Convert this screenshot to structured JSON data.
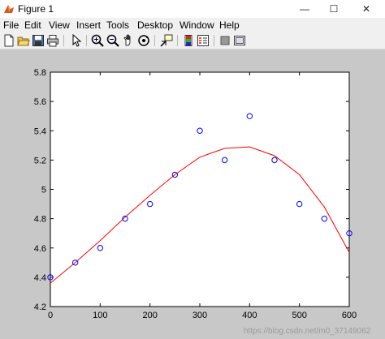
{
  "window": {
    "title": "Figure 1",
    "controls": {
      "minimize": "—",
      "maximize": "☐",
      "close": "✕"
    }
  },
  "menu": {
    "items": [
      "File",
      "Edit",
      "View",
      "Insert",
      "Tools",
      "Desktop",
      "Window",
      "Help"
    ]
  },
  "toolbar": {
    "icons": [
      "new-figure-icon",
      "open-file-icon",
      "save-icon",
      "print-icon",
      "pointer-icon",
      "zoom-in-icon",
      "zoom-out-icon",
      "pan-icon",
      "rotate-3d-icon",
      "data-cursor-icon",
      "colorbar-icon",
      "legend-icon",
      "hide-plot-tools-icon",
      "show-plot-tools-icon"
    ]
  },
  "watermark": "https://blog.csdn.net/m0_37149062",
  "colors": {
    "points": "#0000ff",
    "fit_line": "#ff0000",
    "axes_bg": "#ffffff",
    "figure_bg": "#c8c8c8"
  },
  "chart_data": {
    "type": "scatter",
    "xlim": [
      0,
      600
    ],
    "ylim": [
      4.2,
      5.8
    ],
    "xticks": [
      0,
      100,
      200,
      300,
      400,
      500,
      600
    ],
    "yticks": [
      4.2,
      4.4,
      4.6,
      4.8,
      5,
      5.2,
      5.4,
      5.6,
      5.8
    ],
    "series": [
      {
        "marker": "o",
        "x": [
          0,
          50,
          100,
          150,
          200,
          250,
          300,
          350,
          400,
          450,
          500,
          550,
          600
        ],
        "y": [
          4.4,
          4.5,
          4.6,
          4.8,
          4.9,
          5.1,
          5.4,
          5.2,
          5.5,
          5.2,
          4.9,
          4.8,
          4.7
        ]
      },
      {
        "line": "solid",
        "x": [
          0,
          50,
          100,
          150,
          200,
          250,
          300,
          350,
          400,
          450,
          500,
          550,
          600
        ],
        "y": [
          4.36,
          4.5,
          4.65,
          4.81,
          4.96,
          5.1,
          5.22,
          5.28,
          5.29,
          5.23,
          5.1,
          4.88,
          4.57
        ]
      }
    ]
  }
}
